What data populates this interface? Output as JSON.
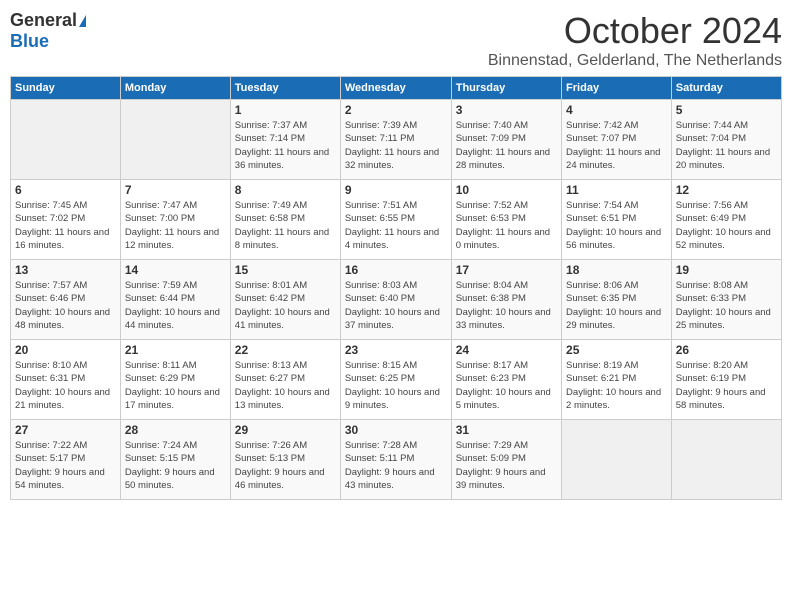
{
  "header": {
    "logo_general": "General",
    "logo_blue": "Blue",
    "month": "October 2024",
    "location": "Binnenstad, Gelderland, The Netherlands"
  },
  "days_of_week": [
    "Sunday",
    "Monday",
    "Tuesday",
    "Wednesday",
    "Thursday",
    "Friday",
    "Saturday"
  ],
  "weeks": [
    [
      {
        "day": "",
        "detail": ""
      },
      {
        "day": "",
        "detail": ""
      },
      {
        "day": "1",
        "detail": "Sunrise: 7:37 AM\nSunset: 7:14 PM\nDaylight: 11 hours and 36 minutes."
      },
      {
        "day": "2",
        "detail": "Sunrise: 7:39 AM\nSunset: 7:11 PM\nDaylight: 11 hours and 32 minutes."
      },
      {
        "day": "3",
        "detail": "Sunrise: 7:40 AM\nSunset: 7:09 PM\nDaylight: 11 hours and 28 minutes."
      },
      {
        "day": "4",
        "detail": "Sunrise: 7:42 AM\nSunset: 7:07 PM\nDaylight: 11 hours and 24 minutes."
      },
      {
        "day": "5",
        "detail": "Sunrise: 7:44 AM\nSunset: 7:04 PM\nDaylight: 11 hours and 20 minutes."
      }
    ],
    [
      {
        "day": "6",
        "detail": "Sunrise: 7:45 AM\nSunset: 7:02 PM\nDaylight: 11 hours and 16 minutes."
      },
      {
        "day": "7",
        "detail": "Sunrise: 7:47 AM\nSunset: 7:00 PM\nDaylight: 11 hours and 12 minutes."
      },
      {
        "day": "8",
        "detail": "Sunrise: 7:49 AM\nSunset: 6:58 PM\nDaylight: 11 hours and 8 minutes."
      },
      {
        "day": "9",
        "detail": "Sunrise: 7:51 AM\nSunset: 6:55 PM\nDaylight: 11 hours and 4 minutes."
      },
      {
        "day": "10",
        "detail": "Sunrise: 7:52 AM\nSunset: 6:53 PM\nDaylight: 11 hours and 0 minutes."
      },
      {
        "day": "11",
        "detail": "Sunrise: 7:54 AM\nSunset: 6:51 PM\nDaylight: 10 hours and 56 minutes."
      },
      {
        "day": "12",
        "detail": "Sunrise: 7:56 AM\nSunset: 6:49 PM\nDaylight: 10 hours and 52 minutes."
      }
    ],
    [
      {
        "day": "13",
        "detail": "Sunrise: 7:57 AM\nSunset: 6:46 PM\nDaylight: 10 hours and 48 minutes."
      },
      {
        "day": "14",
        "detail": "Sunrise: 7:59 AM\nSunset: 6:44 PM\nDaylight: 10 hours and 44 minutes."
      },
      {
        "day": "15",
        "detail": "Sunrise: 8:01 AM\nSunset: 6:42 PM\nDaylight: 10 hours and 41 minutes."
      },
      {
        "day": "16",
        "detail": "Sunrise: 8:03 AM\nSunset: 6:40 PM\nDaylight: 10 hours and 37 minutes."
      },
      {
        "day": "17",
        "detail": "Sunrise: 8:04 AM\nSunset: 6:38 PM\nDaylight: 10 hours and 33 minutes."
      },
      {
        "day": "18",
        "detail": "Sunrise: 8:06 AM\nSunset: 6:35 PM\nDaylight: 10 hours and 29 minutes."
      },
      {
        "day": "19",
        "detail": "Sunrise: 8:08 AM\nSunset: 6:33 PM\nDaylight: 10 hours and 25 minutes."
      }
    ],
    [
      {
        "day": "20",
        "detail": "Sunrise: 8:10 AM\nSunset: 6:31 PM\nDaylight: 10 hours and 21 minutes."
      },
      {
        "day": "21",
        "detail": "Sunrise: 8:11 AM\nSunset: 6:29 PM\nDaylight: 10 hours and 17 minutes."
      },
      {
        "day": "22",
        "detail": "Sunrise: 8:13 AM\nSunset: 6:27 PM\nDaylight: 10 hours and 13 minutes."
      },
      {
        "day": "23",
        "detail": "Sunrise: 8:15 AM\nSunset: 6:25 PM\nDaylight: 10 hours and 9 minutes."
      },
      {
        "day": "24",
        "detail": "Sunrise: 8:17 AM\nSunset: 6:23 PM\nDaylight: 10 hours and 5 minutes."
      },
      {
        "day": "25",
        "detail": "Sunrise: 8:19 AM\nSunset: 6:21 PM\nDaylight: 10 hours and 2 minutes."
      },
      {
        "day": "26",
        "detail": "Sunrise: 8:20 AM\nSunset: 6:19 PM\nDaylight: 9 hours and 58 minutes."
      }
    ],
    [
      {
        "day": "27",
        "detail": "Sunrise: 7:22 AM\nSunset: 5:17 PM\nDaylight: 9 hours and 54 minutes."
      },
      {
        "day": "28",
        "detail": "Sunrise: 7:24 AM\nSunset: 5:15 PM\nDaylight: 9 hours and 50 minutes."
      },
      {
        "day": "29",
        "detail": "Sunrise: 7:26 AM\nSunset: 5:13 PM\nDaylight: 9 hours and 46 minutes."
      },
      {
        "day": "30",
        "detail": "Sunrise: 7:28 AM\nSunset: 5:11 PM\nDaylight: 9 hours and 43 minutes."
      },
      {
        "day": "31",
        "detail": "Sunrise: 7:29 AM\nSunset: 5:09 PM\nDaylight: 9 hours and 39 minutes."
      },
      {
        "day": "",
        "detail": ""
      },
      {
        "day": "",
        "detail": ""
      }
    ]
  ]
}
